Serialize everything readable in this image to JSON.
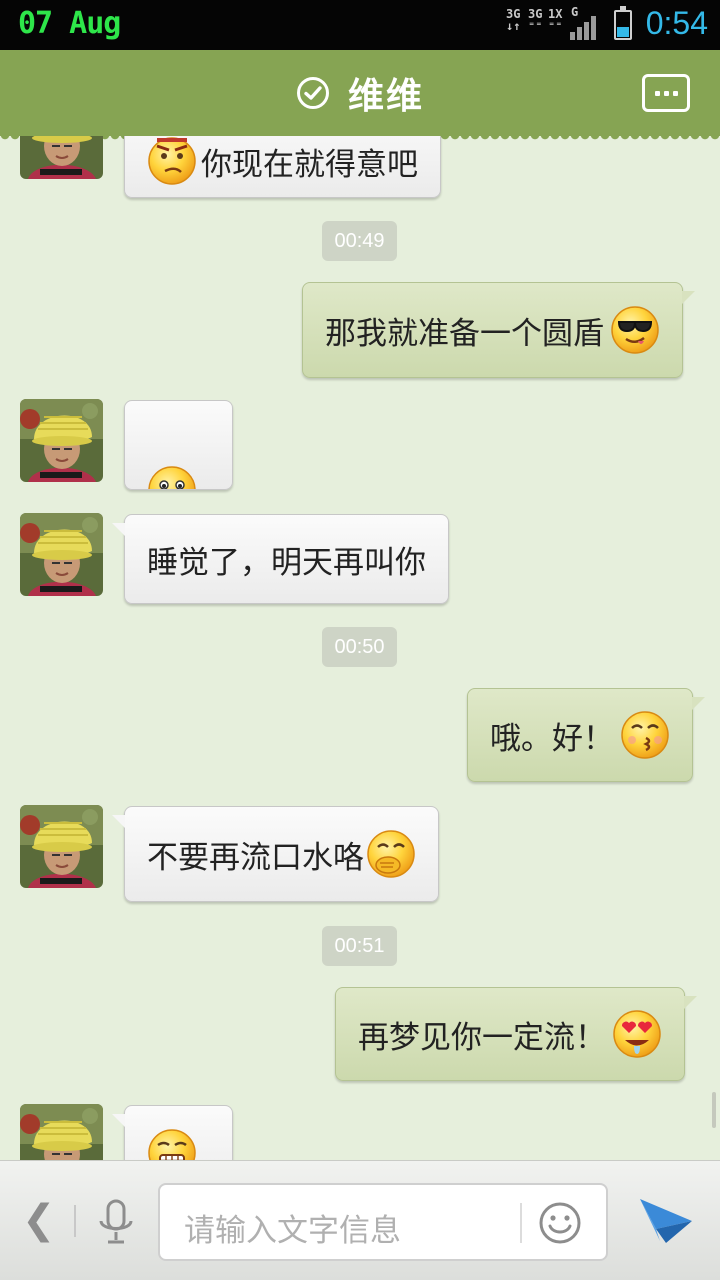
{
  "status_bar": {
    "date": "07  Aug",
    "net_3g_a": "3G",
    "net_3g_b": "3G",
    "net_1x": "1X",
    "net_g": "G",
    "time": "0:54",
    "battery_level": 0.4
  },
  "header": {
    "title": "维维"
  },
  "messages": [
    {
      "side": "in",
      "text": "你现在就得意吧",
      "emoji": "smug-face-icon"
    },
    {
      "type": "time",
      "text": "00:49"
    },
    {
      "side": "out",
      "text": "那我就准备一个圆盾",
      "emoji": "sunglasses-face-icon"
    },
    {
      "side": "in",
      "text": "",
      "emoji": "peeking-face-icon"
    },
    {
      "side": "in",
      "text": "睡觉了，明天再叫你"
    },
    {
      "type": "time",
      "text": "00:50"
    },
    {
      "side": "out",
      "text": "哦。好！",
      "emoji": "kissing-face-icon"
    },
    {
      "side": "in",
      "text": "不要再流口水咯",
      "emoji": "covering-mouth-face-icon"
    },
    {
      "type": "time",
      "text": "00:51"
    },
    {
      "side": "out",
      "text": "再梦见你一定流！",
      "emoji": "heart-eyes-drool-face-icon"
    },
    {
      "side": "in",
      "text": "",
      "emoji": "grimacing-face-icon"
    }
  ],
  "input_bar": {
    "placeholder": "请输入文字信息"
  },
  "colors": {
    "header_bg": "#86a453",
    "chat_bg": "#e6efdc",
    "outgoing_bubble": "#d4e0b8",
    "incoming_bubble": "#f4f4f4",
    "status_date": "#2ee64a",
    "status_time": "#34b9e8",
    "send_icon": "#2f7fcf"
  }
}
